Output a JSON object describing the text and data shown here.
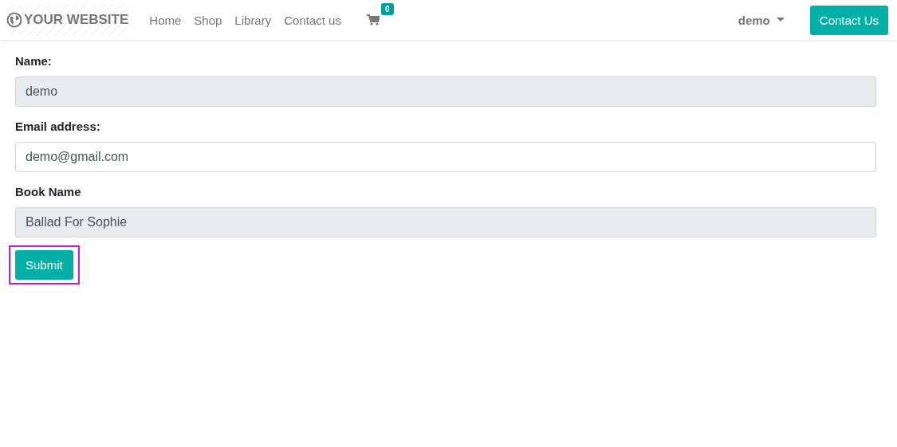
{
  "header": {
    "logo": "YOUR WEBSITE",
    "nav": [
      {
        "label": "Home"
      },
      {
        "label": "Shop"
      },
      {
        "label": "Library"
      },
      {
        "label": "Contact us"
      }
    ],
    "cart_count": "0",
    "user": "demo",
    "cta": "Contact Us"
  },
  "form": {
    "fields": [
      {
        "label": "Name:",
        "value": "demo",
        "disabled": true
      },
      {
        "label": "Email address:",
        "value": "demo@gmail.com",
        "disabled": false
      },
      {
        "label": "Book Name",
        "value": "Ballad For Sophie",
        "disabled": true
      }
    ],
    "submit": {
      "label": "Submit",
      "highlighted": true
    }
  }
}
